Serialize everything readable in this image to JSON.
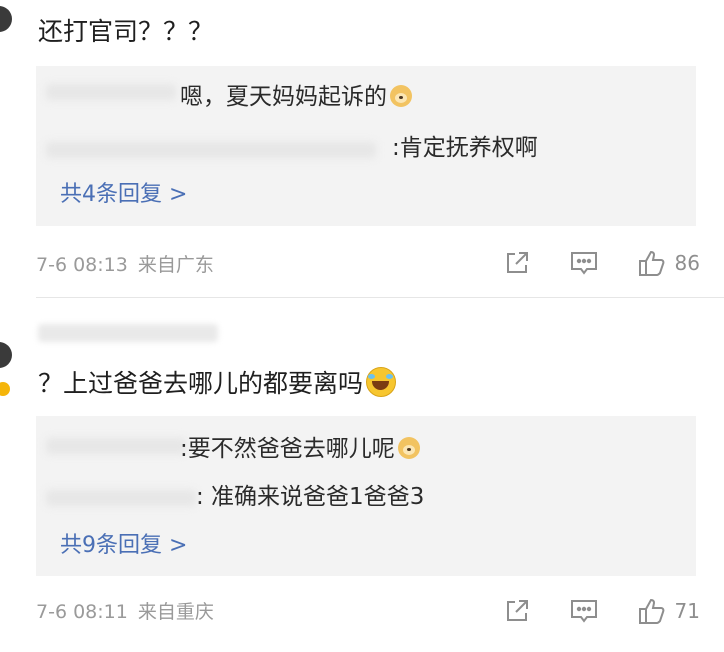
{
  "comments": [
    {
      "text": "还打官司？？？",
      "replies": [
        {
          "text": "嗯，夏天妈妈起诉的",
          "emoji": "doge-emoji"
        },
        {
          "text": ":肯定抚养权啊"
        }
      ],
      "more_replies_label": "共4条回复 >",
      "time": "7-6 08:13",
      "location": "来自广东",
      "like_count": "86"
    },
    {
      "text": "？上过爸爸去哪儿的都要离吗",
      "emoji": "laugh-cry-emoji",
      "replies": [
        {
          "text": ":要不然爸爸去哪儿呢",
          "emoji": "doge-emoji"
        },
        {
          "text": ": 准确来说爸爸1爸爸3"
        }
      ],
      "more_replies_label": "共9条回复 >",
      "time": "7-6 08:11",
      "location": "来自重庆",
      "like_count": "71"
    }
  ],
  "icons": {
    "share": "share-icon",
    "comment": "comment-icon",
    "like": "thumbs-up-icon"
  },
  "colors": {
    "link": "#4a6fb5",
    "meta": "#9a9a9a",
    "reply_bg": "#f3f3f3"
  }
}
